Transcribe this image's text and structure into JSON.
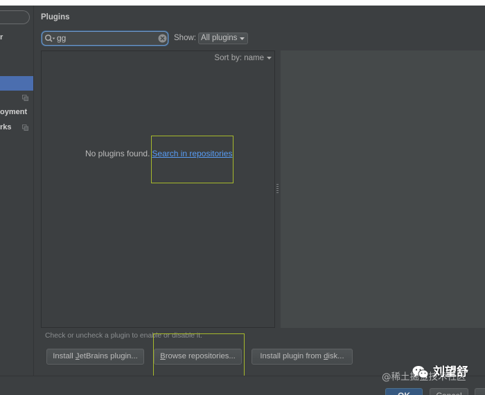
{
  "header": {
    "title": "Plugins"
  },
  "sidebar": {
    "items": [
      {
        "label": "r"
      },
      {
        "label": "oyment"
      },
      {
        "label": "rks"
      }
    ]
  },
  "search": {
    "value": "gg"
  },
  "filter": {
    "label": "Show:",
    "selected": "All plugins"
  },
  "plugin_list": {
    "sort_label": "Sort by: name",
    "empty_message": "No plugins found.",
    "empty_link": "Search in repositories"
  },
  "hint": "Check or uncheck a plugin to enable or disable it.",
  "actions": [
    {
      "label": "Install JetBrains plugin...",
      "mnemonic": "J"
    },
    {
      "label": "Browse repositories...",
      "mnemonic": "B"
    },
    {
      "label": "Install plugin from disk...",
      "mnemonic": "d"
    }
  ],
  "dialog_buttons": [
    {
      "label": "OK"
    },
    {
      "label": "Cancel"
    }
  ],
  "watermark": {
    "author": "刘望舒",
    "site": "@稀土掘金技术社区"
  },
  "icons": {
    "search": "search-icon",
    "clear": "clear-search-icon",
    "dropdown": "chevron-down-icon",
    "scope": "project-scope-icon",
    "splitter": "splitter-handle-icon",
    "watermark": "wechat-icon"
  },
  "colors": {
    "background": "#3c3f41",
    "details_panel": "#45494a",
    "selection": "#4b6eaf",
    "link": "#589df6",
    "annotation": "#a8ba2c",
    "ok_button": "#365880",
    "text": "#bbbbbb"
  }
}
